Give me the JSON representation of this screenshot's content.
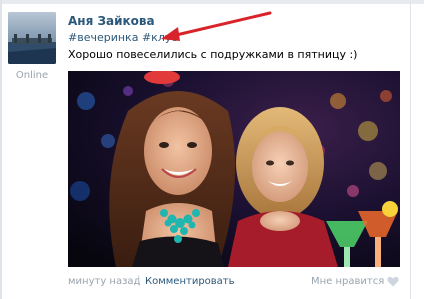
{
  "post": {
    "author": "Аня Зайкова",
    "status": "Online",
    "tags": [
      "#вечеринка",
      "#клуб"
    ],
    "text": "Хорошо повеселились с подружками в пятницу :)",
    "time": "минуту назад",
    "separator": "|",
    "comment_label": "Комментировать",
    "like_label": "Мне нравится"
  },
  "colors": {
    "link": "#2b587a",
    "muted": "#9aa4ad",
    "annotation_arrow": "#d9232a"
  },
  "icons": {
    "like": "heart-icon",
    "arrow": "red-arrow-icon"
  }
}
